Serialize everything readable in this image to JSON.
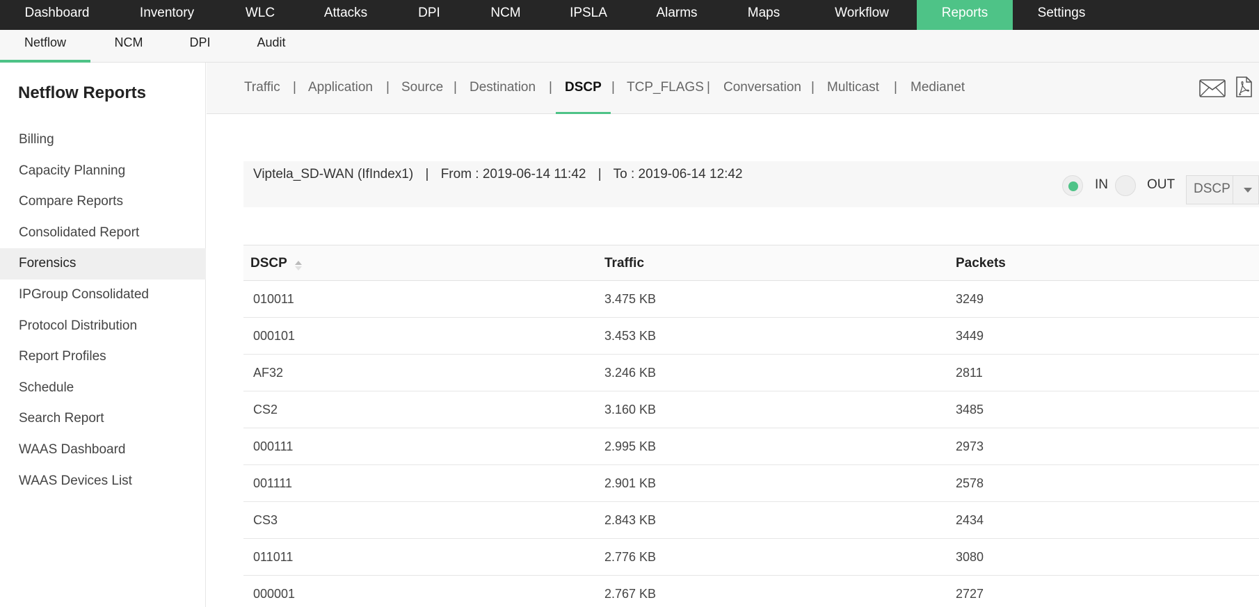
{
  "topnav": {
    "items": [
      "Dashboard",
      "Inventory",
      "WLC",
      "Attacks",
      "DPI",
      "NCM",
      "IPSLA",
      "Alarms",
      "Maps",
      "Workflow",
      "Reports",
      "Settings"
    ],
    "active": "Reports"
  },
  "subnav": {
    "items": [
      "Netflow",
      "NCM",
      "DPI",
      "Audit"
    ],
    "active": "Netflow"
  },
  "sidebar": {
    "title": "Netflow Reports",
    "items": [
      "Billing",
      "Capacity Planning",
      "Compare Reports",
      "Consolidated Report",
      "Forensics",
      "IPGroup Consolidated",
      "Protocol Distribution",
      "Report Profiles",
      "Schedule",
      "Search Report",
      "WAAS Dashboard",
      "WAAS Devices List"
    ],
    "active": "Forensics"
  },
  "tabs": {
    "items": [
      "Traffic",
      "Application",
      "Source",
      "Destination",
      "DSCP",
      "TCP_FLAGS",
      "Conversation",
      "Multicast",
      "Medianet"
    ],
    "active": "DSCP",
    "separator": "|"
  },
  "toolbar": {
    "email_icon": "envelope-icon",
    "pdf_icon": "pdf-icon"
  },
  "info": {
    "device": "Viptela_SD-WAN (IfIndex1)",
    "separator": "|",
    "from": "From : 2019-06-14 11:42",
    "to": "To : 2019-06-14 12:42"
  },
  "direction": {
    "in_label": "IN",
    "out_label": "OUT",
    "selected": "IN"
  },
  "select": {
    "value": "DSCP"
  },
  "colors": {
    "accent": "#4ec387",
    "topnav_bg": "#262626"
  },
  "table": {
    "columns": [
      "DSCP",
      "Traffic",
      "Packets"
    ],
    "rows": [
      [
        "010011",
        "3.475 KB",
        "3249"
      ],
      [
        "000101",
        "3.453 KB",
        "3449"
      ],
      [
        "AF32",
        "3.246 KB",
        "2811"
      ],
      [
        "CS2",
        "3.160 KB",
        "3485"
      ],
      [
        "000111",
        "2.995 KB",
        "2973"
      ],
      [
        "001111",
        "2.901 KB",
        "2578"
      ],
      [
        "CS3",
        "2.843 KB",
        "2434"
      ],
      [
        "011011",
        "2.776 KB",
        "3080"
      ],
      [
        "000001",
        "2.767 KB",
        "2727"
      ]
    ]
  }
}
